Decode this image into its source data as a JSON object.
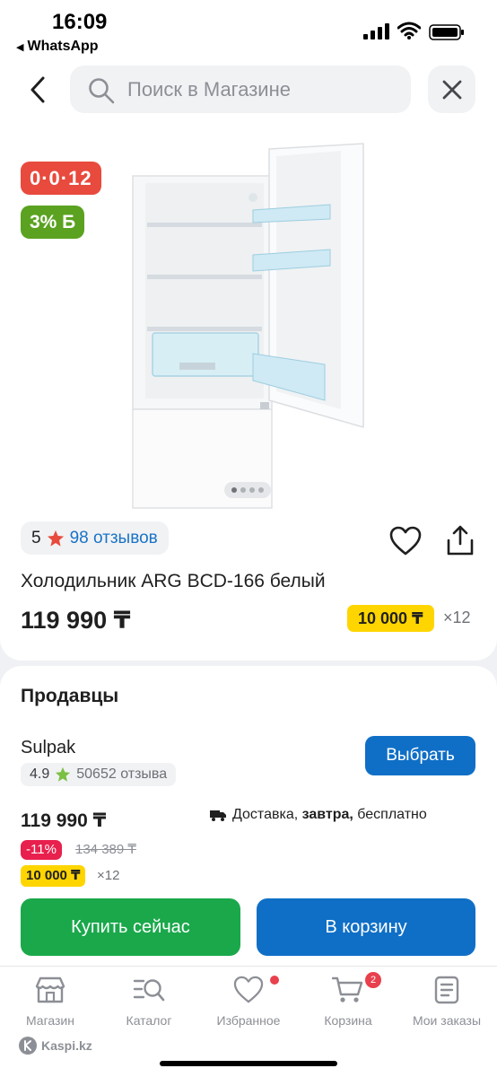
{
  "status_bar": {
    "time": "16:09",
    "back_app": "WhatsApp"
  },
  "header": {
    "search_placeholder": "Поиск в Магазине"
  },
  "product": {
    "installment_badge": "0·0·12",
    "bonus_badge": "3% Б",
    "rating": "5",
    "reviews": "98 отзывов",
    "title": "Холодильник ARG BCD-166 белый",
    "price": "119 990 ₸",
    "monthly": "10 000 ₸",
    "term": "×12",
    "image_count": 4,
    "image_active": 1
  },
  "sellers": {
    "title": "Продавцы",
    "seller": {
      "name": "Sulpak",
      "rating": "4.9",
      "reviews": "50652 отзыва",
      "choose_label": "Выбрать",
      "price": "119 990 ₸",
      "delivery_prefix": "Доставка,",
      "delivery_when": "завтра,",
      "delivery_suffix": "бесплатно",
      "discount": "-11%",
      "old_price": "134 389 ₸",
      "monthly": "10 000 ₸",
      "term": "×12"
    },
    "buy_now_label": "Купить сейчас",
    "cart_label": "В корзину"
  },
  "tabs": [
    {
      "label": "Магазин",
      "icon": "store-icon"
    },
    {
      "label": "Каталог",
      "icon": "catalog-search-icon"
    },
    {
      "label": "Избранное",
      "icon": "heart-icon"
    },
    {
      "label": "Корзина",
      "icon": "cart-icon",
      "badge": "2"
    },
    {
      "label": "Мои заказы",
      "icon": "orders-icon"
    }
  ],
  "footer": {
    "logo_text": "Kaspi.kz"
  },
  "colors": {
    "primary_blue": "#0f6fc6",
    "buy_green": "#1aa84b",
    "installment_red": "#e84a3d",
    "bonus_green": "#5aa220",
    "monthly_yellow": "#ffd500"
  }
}
